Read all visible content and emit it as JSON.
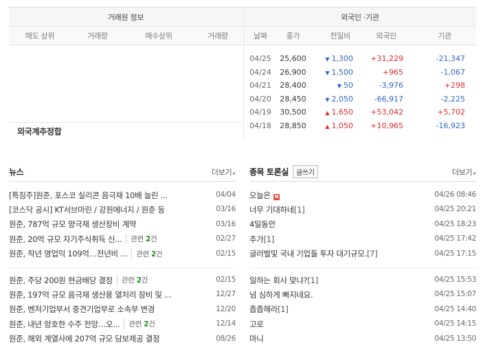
{
  "broker": {
    "title": "거래원 정보",
    "headers": [
      "매도 상위",
      "거래량",
      "매수상위",
      "거래량"
    ],
    "combined_label": "외국계추정합"
  },
  "foreign": {
    "title": "외국인 ·기관",
    "headers": [
      "날짜",
      "종가",
      "전일비",
      "외국인",
      "기관"
    ],
    "rows": [
      {
        "date": "04/25",
        "close": "25,600",
        "change": "1,300",
        "dir": "down",
        "foreign": "+31,229",
        "inst": "-21,347"
      },
      {
        "date": "04/24",
        "close": "26,900",
        "change": "1,500",
        "dir": "down",
        "foreign": "+965",
        "inst": "-1,067"
      },
      {
        "date": "04/21",
        "close": "28,400",
        "change": "50",
        "dir": "down",
        "foreign": "-3,976",
        "inst": "+298"
      },
      {
        "date": "04/20",
        "close": "28,450",
        "change": "2,050",
        "dir": "down",
        "foreign": "-66,917",
        "inst": "-2,225"
      },
      {
        "date": "04/19",
        "close": "30,500",
        "change": "1,650",
        "dir": "up",
        "foreign": "+53,042",
        "inst": "+5,702"
      },
      {
        "date": "04/18",
        "close": "28,850",
        "change": "1,050",
        "dir": "up",
        "foreign": "+10,965",
        "inst": "-16,923"
      }
    ]
  },
  "news": {
    "title": "뉴스",
    "more": "더보기",
    "group1": [
      {
        "title": "[특징주]원준, 포스코 실리콘 음극재 10배 늘린 ...",
        "date": "04/04"
      },
      {
        "title": "[코스닥 공시] KT서브마린 / 강원에너지 / 원준 등",
        "date": "03/16"
      },
      {
        "title": "원준, 787억 규모 양극재 생산장비 계약",
        "date": "03/16"
      },
      {
        "title": "원준, 20억 규모 자기주식취득 신...",
        "date": "02/27",
        "rel_label": "관련",
        "rel_count": "2",
        "rel_unit": "건"
      },
      {
        "title": "원준, 작년 영업익 109억…전년비 ...",
        "date": "02/15",
        "rel_label": "관련",
        "rel_count": "2",
        "rel_unit": "건"
      }
    ],
    "group2": [
      {
        "title": "원준, 주당 200원 현금배당 결정",
        "date": "02/15",
        "rel_label": "관련",
        "rel_count": "2",
        "rel_unit": "건"
      },
      {
        "title": "원준, 197억 규모 음극재 생산용 열처리 장비 및 ...",
        "date": "12/27"
      },
      {
        "title": "원준, 벤처기업부서 중견기업부로 소속부 변경",
        "date": "12/20"
      },
      {
        "title": "원준, 내년 양호한 수주 전망…오...",
        "date": "12/14",
        "rel_label": "관련",
        "rel_count": "2",
        "rel_unit": "건"
      },
      {
        "title": "원준, 해외 계열사에 207억 규모 담보제공 결정",
        "date": "08/26"
      }
    ]
  },
  "board": {
    "title": "종목 토론실",
    "write": "글쓰기",
    "more": "더보기",
    "group1": [
      {
        "title": "오늘은",
        "badge": "N",
        "date": "04/26 08:46"
      },
      {
        "title": "너무 기대하네",
        "count": "[1]",
        "date": "04/25 20:21"
      },
      {
        "title": "4일동안",
        "date": "04/25 18:23"
      },
      {
        "title": "추가",
        "count": "[1]",
        "date": "04/25 17:42"
      },
      {
        "title": "글러벌및 국내 기업들 투자 대기규모.",
        "count": "[7]",
        "date": "04/25 17:15"
      }
    ],
    "group2": [
      {
        "title": "일하는 회사 맞냐?",
        "count": "[1]",
        "date": "04/25 15:53"
      },
      {
        "title": "넘 심하게 빠지네요.",
        "date": "04/25 15:07"
      },
      {
        "title": "좁좁해라",
        "count": "[1]",
        "date": "04/25 14:40"
      },
      {
        "title": "고로",
        "date": "04/25 14:15"
      },
      {
        "title": "마니",
        "date": "04/25 13:50"
      }
    ]
  },
  "colors": {
    "up": "#e0282c",
    "down": "#2d63c8",
    "related_count": "#1f8c1f"
  }
}
